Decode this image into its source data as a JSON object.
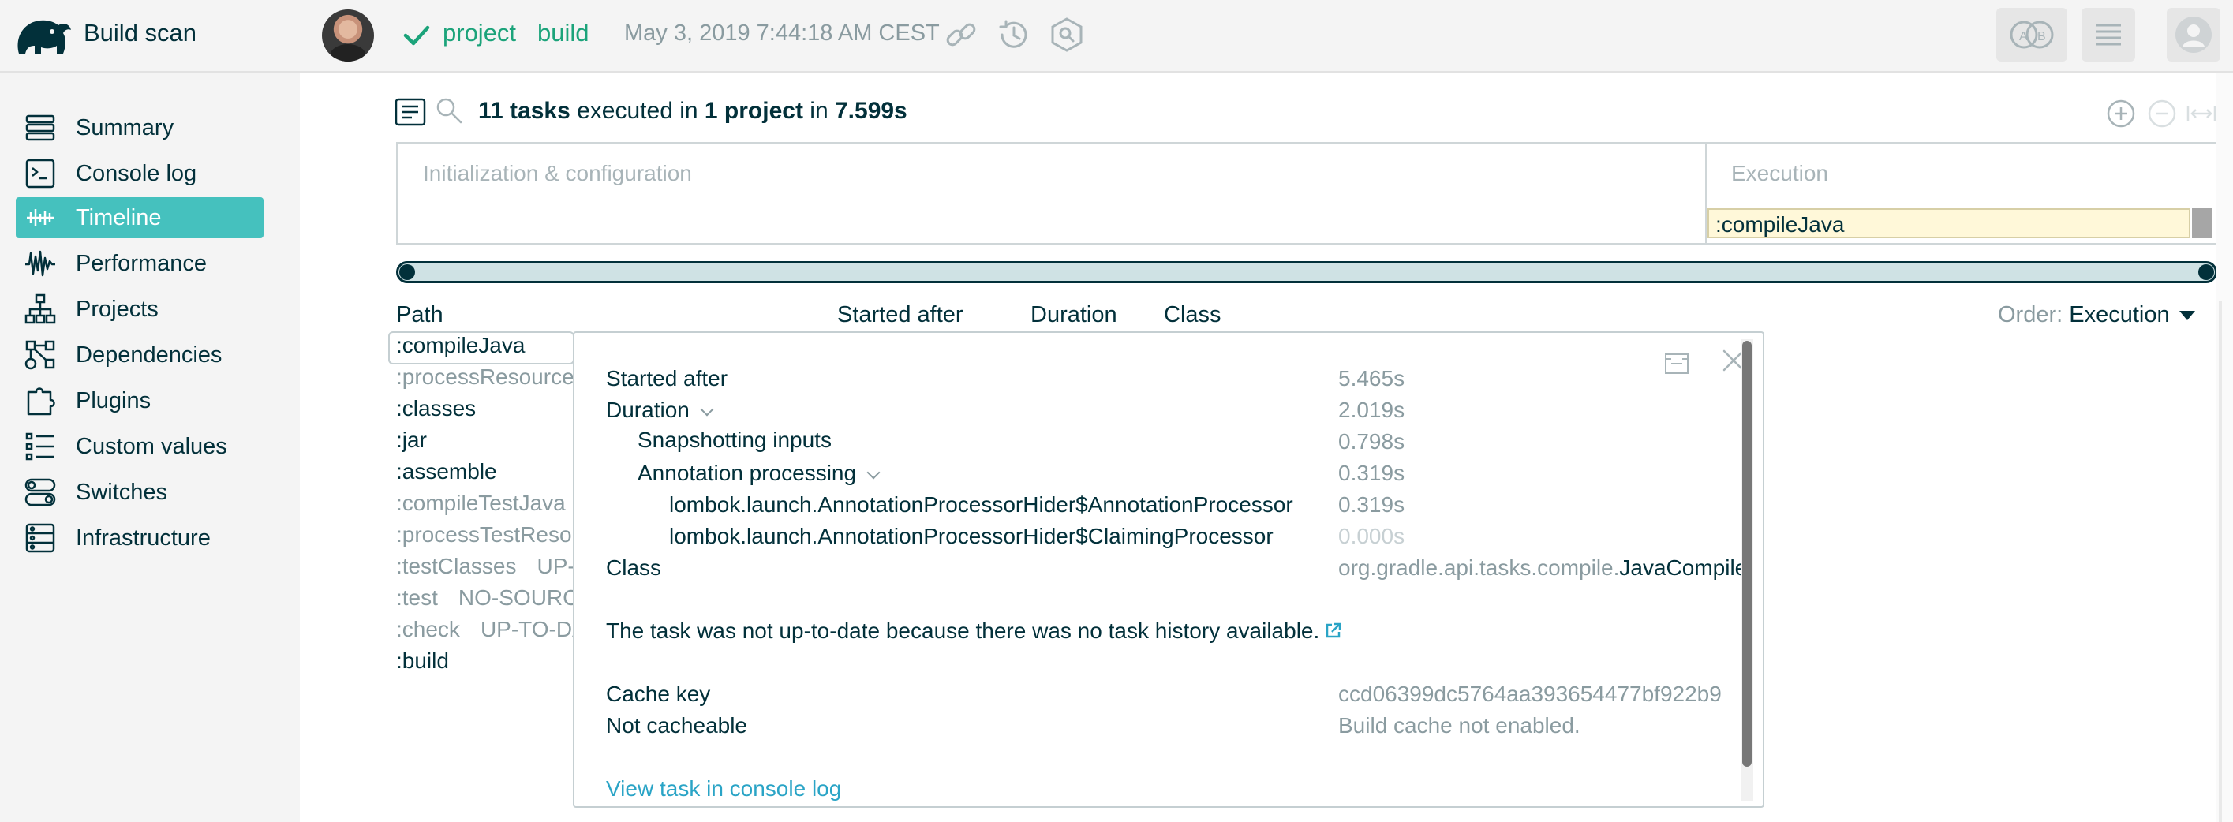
{
  "header": {
    "brand": "Build scan",
    "tag_project": "project",
    "tag_build": "build",
    "timestamp": "May 3, 2019 7:44:18 AM CEST",
    "icons": [
      "elephant-logo-icon",
      "check-icon",
      "link-icon",
      "history-icon",
      "plugin-hex-icon",
      "compare-icon",
      "list-icon",
      "user-icon"
    ]
  },
  "sidebar": {
    "items": [
      {
        "label": "Summary",
        "icon": "summary-icon"
      },
      {
        "label": "Console log",
        "icon": "console-icon"
      },
      {
        "label": "Timeline",
        "icon": "timeline-icon",
        "active": true
      },
      {
        "label": "Performance",
        "icon": "performance-icon"
      },
      {
        "label": "Projects",
        "icon": "projects-icon"
      },
      {
        "label": "Dependencies",
        "icon": "dependencies-icon"
      },
      {
        "label": "Plugins",
        "icon": "plugins-icon"
      },
      {
        "label": "Custom values",
        "icon": "custom-values-icon"
      },
      {
        "label": "Switches",
        "icon": "switches-icon"
      },
      {
        "label": "Infrastructure",
        "icon": "infrastructure-icon"
      }
    ]
  },
  "summary": {
    "count": "11 tasks",
    "text1": " executed in ",
    "projects": "1 project",
    "text2": " in ",
    "duration": "7.599s"
  },
  "timeline": {
    "init_label": "Initialization & configuration",
    "exec_label": "Execution",
    "bar_label": ":compileJava"
  },
  "table": {
    "columns": [
      "Path",
      "Started after",
      "Duration",
      "Class"
    ],
    "order_label": "Order:",
    "order_value": "Execution",
    "rows": [
      {
        "path": ":compileJava",
        "status": "",
        "style": "dark"
      },
      {
        "path": ":processResources",
        "status": "",
        "style": "muted"
      },
      {
        "path": ":classes",
        "status": "",
        "style": "dark"
      },
      {
        "path": ":jar",
        "status": "",
        "style": "dark"
      },
      {
        "path": ":assemble",
        "status": "",
        "style": "dark"
      },
      {
        "path": ":compileTestJava",
        "status": "",
        "style": "muted"
      },
      {
        "path": ":processTestResou",
        "status": "",
        "style": "muted"
      },
      {
        "path": ":testClasses",
        "status": "UP-T",
        "style": "muted"
      },
      {
        "path": ":test",
        "status": "NO-SOURC",
        "style": "muted"
      },
      {
        "path": ":check",
        "status": "UP-TO-DA",
        "style": "muted"
      },
      {
        "path": ":build",
        "status": "",
        "style": "dark"
      }
    ]
  },
  "popup": {
    "started_after_label": "Started after",
    "started_after_value": "5.465s",
    "duration_label": "Duration",
    "duration_value": "2.019s",
    "snapshot_label": "Snapshotting inputs",
    "snapshot_value": "0.798s",
    "annotation_label": "Annotation processing",
    "annotation_value": "0.319s",
    "proc1_label": "lombok.launch.AnnotationProcessorHider$AnnotationProcessor",
    "proc1_value": "0.319s",
    "proc2_label": "lombok.launch.AnnotationProcessorHider$ClaimingProcessor",
    "proc2_value": "0.000s",
    "class_label": "Class",
    "class_pkg": "org.gradle.api.tasks.compile.",
    "class_name": "JavaCompile",
    "reason": "The task was not up-to-date because there was no task history available.",
    "cache_key_label": "Cache key",
    "cache_key_value": "ccd06399dc5764aa393654477bf922b9",
    "cacheable_label": "Not cacheable",
    "cacheable_value": "Build cache not enabled.",
    "console_link": "View task in console log"
  },
  "colors": {
    "accent": "#45c1be",
    "success": "#1ba37a",
    "text": "#02303a",
    "muted": "#8a9ba0",
    "link": "#2aa4c6"
  }
}
